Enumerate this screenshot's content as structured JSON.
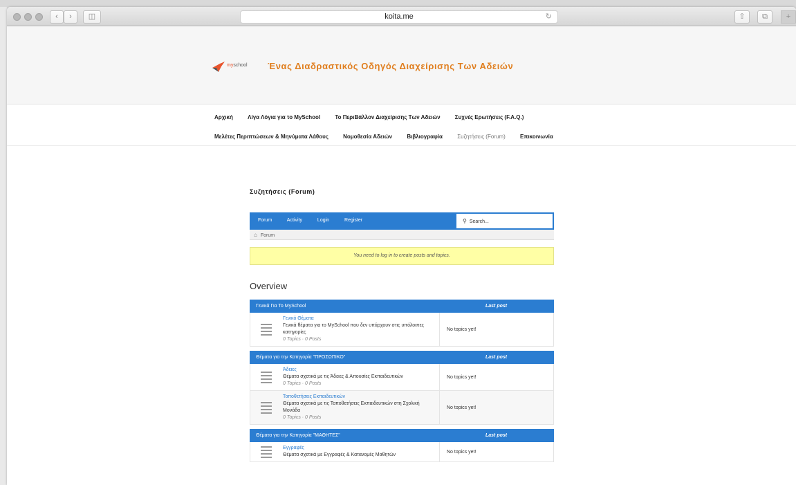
{
  "browser": {
    "url": "koita.me",
    "reload_icon": "reload-icon",
    "share_icon": "share-icon",
    "tabs_icon": "tabs-icon",
    "new_tab_label": "+"
  },
  "site": {
    "logo_text_my": "my",
    "logo_text_school": "school",
    "title": "Ένας Διαδραστικός Οδηγός Διαχείρισης Των Αδειών"
  },
  "nav": {
    "row1": [
      "Αρχική",
      "Λίγα Λόγια για το MySchool",
      "Το ΠεριΒάλλον Διαχείρισης Των Αδειών",
      "Συχνές Ερωτήσεις (F.A.Q.)"
    ],
    "row2": [
      "Μελέτες Περιπτώσεων & Μηνύματα Λάθους",
      "Νομοθεσία Αδειών",
      "Βιβλιογραφία",
      "Συζητήσεις (Forum)",
      "Επικοινωνία"
    ]
  },
  "page": {
    "heading": "Συζητήσεις (Forum)"
  },
  "forum": {
    "menu": [
      "Forum",
      "Activity",
      "Login",
      "Register"
    ],
    "search_placeholder": "Search...",
    "breadcrumb": "Forum",
    "notice": "You need to log in to create posts and topics.",
    "overview": "Overview",
    "last_post_label": "Last post",
    "categories": [
      {
        "name": "Γενικά Για Το MySchool",
        "forums": [
          {
            "title": "Γενικό Θέματα",
            "desc": "Γενικά θέματα για το MySchool που δεν υπάρχουν στις υπόλοιπες κατηγορίες",
            "stats": "0 Topics · 0 Posts",
            "last": "No topics yet!"
          }
        ]
      },
      {
        "name": "Θέματα για την Κατηγορία \"ΠΡΟΣΩΠΙΚΟ\"",
        "forums": [
          {
            "title": "Άδειες",
            "desc": "Θέματα σχετικά με τις Άδειες & Απουσίες Εκπαιδευτικών",
            "stats": "0 Topics · 0 Posts",
            "last": "No topics yet!"
          },
          {
            "title": "Τοποθετήσεις Εκπαιδευτικών",
            "desc": "Θέματα σχετικά με τις Τοποθετήσεις Εκπαιδευτικών στη Σχολική Μονάδα",
            "stats": "0 Topics · 0 Posts",
            "last": "No topics yet!"
          }
        ]
      },
      {
        "name": "Θέματα για την Κατηγορία \"ΜΑΘΗΤΕΣ\"",
        "forums": [
          {
            "title": "Εγγραφές",
            "desc": "Θέματα σχετικά με Εγγραφές & Κατανομές Μαθητών",
            "stats": "",
            "last": "No topics yet!"
          }
        ]
      }
    ]
  }
}
